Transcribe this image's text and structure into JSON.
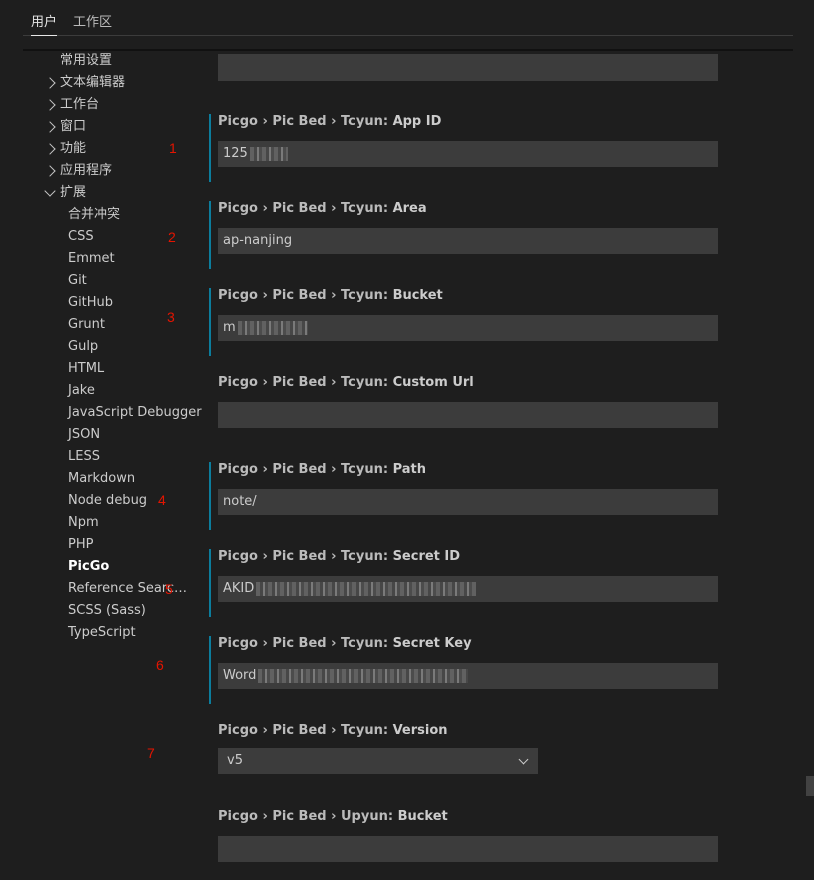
{
  "tabs": {
    "user": "用户",
    "workspace": "工作区"
  },
  "toc": [
    {
      "label": "常用设置",
      "indent": 1,
      "chevron": ""
    },
    {
      "label": "文本编辑器",
      "indent": 1,
      "chevron": "right"
    },
    {
      "label": "工作台",
      "indent": 1,
      "chevron": "right"
    },
    {
      "label": "窗口",
      "indent": 1,
      "chevron": "right"
    },
    {
      "label": "功能",
      "indent": 1,
      "chevron": "right"
    },
    {
      "label": "应用程序",
      "indent": 1,
      "chevron": "right"
    },
    {
      "label": "扩展",
      "indent": 1,
      "chevron": "down"
    },
    {
      "label": "合并冲突",
      "indent": 2
    },
    {
      "label": "CSS",
      "indent": 2
    },
    {
      "label": "Emmet",
      "indent": 2
    },
    {
      "label": "Git",
      "indent": 2
    },
    {
      "label": "GitHub",
      "indent": 2
    },
    {
      "label": "Grunt",
      "indent": 2
    },
    {
      "label": "Gulp",
      "indent": 2
    },
    {
      "label": "HTML",
      "indent": 2
    },
    {
      "label": "Jake",
      "indent": 2
    },
    {
      "label": "JavaScript Debugger",
      "indent": 2
    },
    {
      "label": "JSON",
      "indent": 2
    },
    {
      "label": "LESS",
      "indent": 2
    },
    {
      "label": "Markdown",
      "indent": 2
    },
    {
      "label": "Node debug",
      "indent": 2
    },
    {
      "label": "Npm",
      "indent": 2
    },
    {
      "label": "PHP",
      "indent": 2
    },
    {
      "label": "PicGo",
      "indent": 2,
      "bold": true
    },
    {
      "label": "Reference Search View",
      "indent": 2,
      "ellipsis": true
    },
    {
      "label": "SCSS (Sass)",
      "indent": 2
    },
    {
      "label": "TypeScript",
      "indent": 2
    }
  ],
  "annotations": [
    "1",
    "2",
    "3",
    "4",
    "5",
    "6",
    "7"
  ],
  "settings": [
    {
      "category": "Picgo › Pic Bed › Tcyun: ",
      "name": "App ID",
      "value": "125",
      "modified": true,
      "redacted": true
    },
    {
      "category": "Picgo › Pic Bed › Tcyun: ",
      "name": "Area",
      "value": "ap-nanjing",
      "modified": true
    },
    {
      "category": "Picgo › Pic Bed › Tcyun: ",
      "name": "Bucket",
      "value": "m",
      "modified": true,
      "redacted": true
    },
    {
      "category": "Picgo › Pic Bed › Tcyun: ",
      "name": "Custom Url",
      "value": "",
      "modified": false
    },
    {
      "category": "Picgo › Pic Bed › Tcyun: ",
      "name": "Path",
      "value": "note/",
      "modified": true
    },
    {
      "category": "Picgo › Pic Bed › Tcyun: ",
      "name": "Secret ID",
      "value": "AKID",
      "modified": true,
      "redacted": true
    },
    {
      "category": "Picgo › Pic Bed › Tcyun: ",
      "name": "Secret Key",
      "value": "Word",
      "modified": true,
      "redacted": true
    },
    {
      "category": "Picgo › Pic Bed › Tcyun: ",
      "name": "Version",
      "value": "v5",
      "modified": false,
      "type": "select"
    },
    {
      "category": "Picgo › Pic Bed › Upyun: ",
      "name": "Bucket",
      "value": "",
      "modified": false
    }
  ],
  "colors": {
    "modified_bar": "#0c7d9d",
    "annotation": "#e51400",
    "input_bg": "#3c3c3c"
  }
}
